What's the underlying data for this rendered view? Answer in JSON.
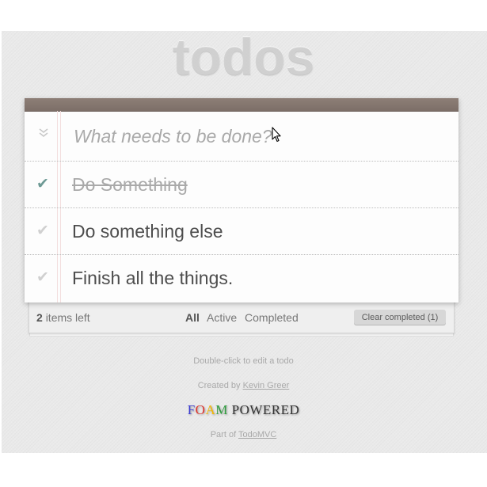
{
  "header": {
    "title": "todos"
  },
  "new_todo": {
    "placeholder": "What needs to be done?",
    "toggle_all_glyph": "»"
  },
  "todos": [
    {
      "label": "Do Something",
      "completed": true,
      "check_glyph": "✔"
    },
    {
      "label": "Do something else",
      "completed": false,
      "check_glyph": "✔"
    },
    {
      "label": "Finish all the things.",
      "completed": false,
      "check_glyph": "✔"
    }
  ],
  "footer": {
    "count": "2",
    "items_left": "items left",
    "filters": [
      "All",
      "Active",
      "Completed"
    ],
    "selected_filter": "All",
    "clear_label": "Clear completed (1)"
  },
  "info": {
    "edit_hint": "Double-click to edit a todo",
    "created_by": "Created by",
    "author": "Kevin Greer",
    "powered_f": "F",
    "powered_o": "O",
    "powered_a": "A",
    "powered_m": "M",
    "powered_word": "POWERED",
    "part_of": "Part of",
    "todomvc": "TodoMVC"
  },
  "colors": {
    "bar": "#8d7e76",
    "check_done": "#6e9a95",
    "foam_f": "#3b3bd1",
    "foam_o": "#e0342c",
    "foam_a": "#f2b500",
    "foam_m": "#2f9e3e"
  }
}
